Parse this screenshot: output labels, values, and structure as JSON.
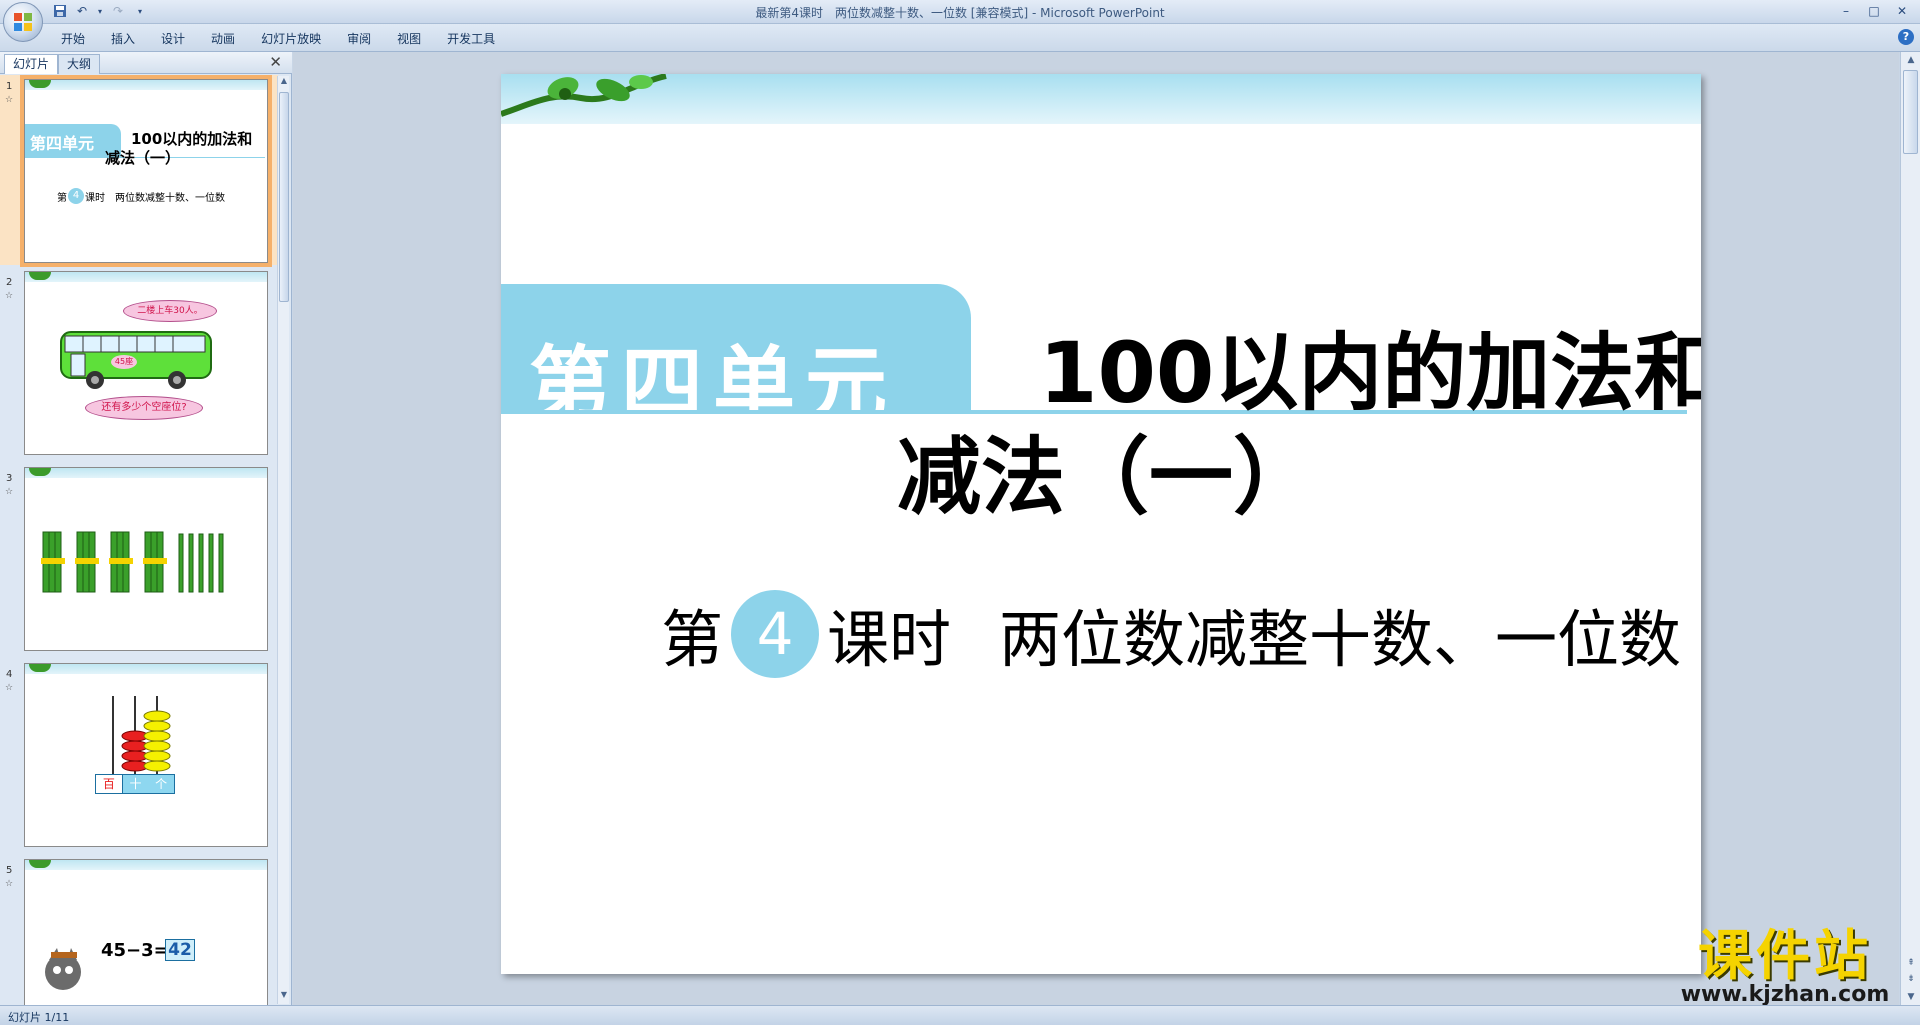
{
  "window": {
    "title": "最新第4课时　两位数减整十数、一位数 [兼容模式] - Microsoft PowerPoint",
    "controls": [
      "–",
      "□",
      "✕"
    ]
  },
  "ribbon": {
    "tabs": [
      "开始",
      "插入",
      "设计",
      "动画",
      "幻灯片放映",
      "审阅",
      "视图",
      "开发工具"
    ],
    "help": "?"
  },
  "left_panel": {
    "tab_slides": "幻灯片",
    "tab_outline": "大纲",
    "close": "✕",
    "thumbnails": [
      {
        "num": "1",
        "unit": "第四单元",
        "title_a": "100以内的加法和",
        "title_b": "减法（一）",
        "lesson_a": "第",
        "lesson_num": "4",
        "lesson_b": "课时　两位数减整十数、一位数"
      },
      {
        "num": "2",
        "bubble_top": "二楼上车30人。",
        "bus_label": "45座",
        "bubble_bottom": "还有多少个空座位?"
      },
      {
        "num": "3"
      },
      {
        "num": "4",
        "abacus_labels": [
          "百",
          "十",
          "个"
        ]
      },
      {
        "num": "5",
        "equation": "45−3=",
        "answer": "42"
      }
    ]
  },
  "slide": {
    "unit": "第四单元",
    "title_line1": "100以内的加法和",
    "title_line2": "减法（一）",
    "lesson_prefix": "第",
    "lesson_number": "4",
    "lesson_suffix": "课时",
    "lesson_topic": "两位数减整十数、一位数"
  },
  "watermark": {
    "cn": "课件站",
    "url": "www.kjzhan.com"
  },
  "status": {
    "slide_counter": "幻灯片 1/11"
  },
  "colors": {
    "accent_blue": "#8dd3ea",
    "selection_orange": "#f5b06a",
    "watermark_yellow": "#f5d300"
  }
}
